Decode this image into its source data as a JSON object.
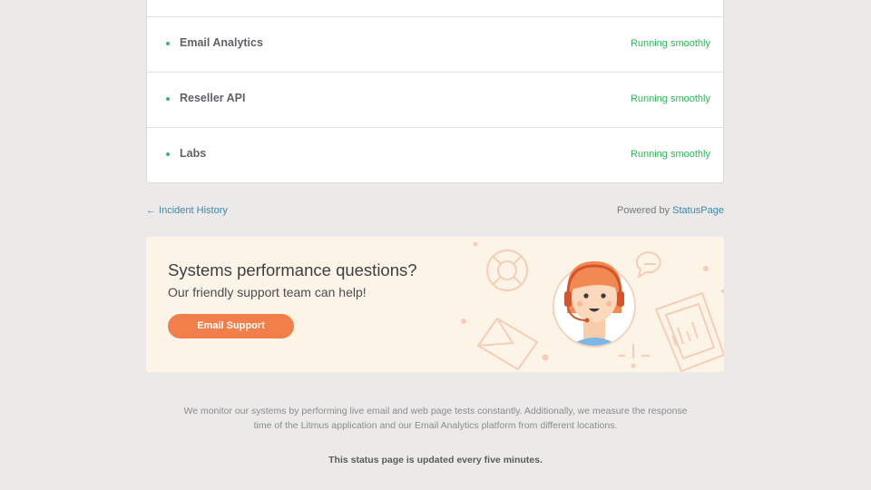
{
  "components": [
    {
      "name": "Email Analytics",
      "status": "Running smoothly"
    },
    {
      "name": "Reseller API",
      "status": "Running smoothly"
    },
    {
      "name": "Labs",
      "status": "Running smoothly"
    }
  ],
  "footer": {
    "history_link": "← Incident History",
    "powered_by_prefix": "Powered by ",
    "powered_by_link": "StatusPage"
  },
  "support": {
    "title": "Systems performance questions?",
    "subtitle": "Our friendly support team can help!",
    "button_label": "Email Support",
    "icons": [
      "lifebuoy-icon",
      "speech-bubble-icon",
      "envelope-icon",
      "support-agent-avatar",
      "chart-document-icon",
      "x-mark-icon",
      "exclamation-icon"
    ]
  },
  "info": {
    "monitor_text": "We monitor our systems by performing live email and web page tests constantly. Additionally, we measure the response time of the Litmus application and our Email Analytics platform from different locations.",
    "update_note": "This status page is updated every five minutes."
  },
  "colors": {
    "status_green": "#2fb45a",
    "link_blue": "#3a87ad",
    "button_orange": "#f27f4a",
    "support_bg": "#fdf4e8",
    "page_bg": "#ebeae8"
  }
}
